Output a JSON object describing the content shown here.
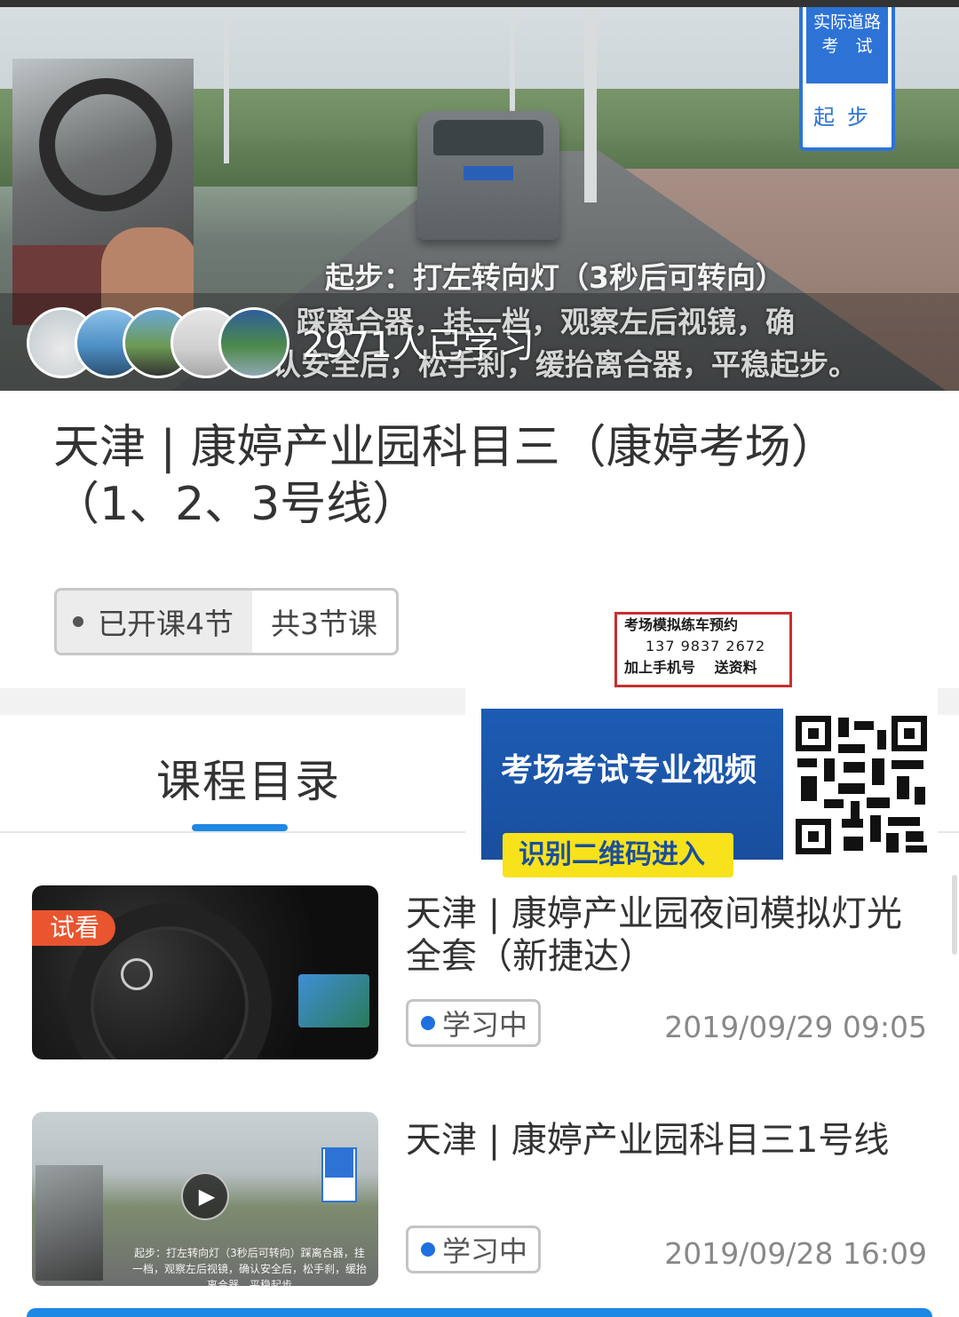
{
  "hero": {
    "learners_text": "2971人已学习",
    "caption_line1": "起步：打左转向灯（3秒后可转向）",
    "caption_line2": "踩离合器，挂一档，观察左后视镜，确",
    "caption_line3": "认安全后，松手刹，缓抬离合器，平稳起步。",
    "sign_top": "实际道路考　试",
    "sign_bottom": "起步",
    "avatars": [
      "learner-avatar-1",
      "learner-avatar-2",
      "learner-avatar-3",
      "learner-avatar-4",
      "learner-avatar-5"
    ]
  },
  "course": {
    "title": "天津 | 康婷产业园科目三（康婷考场）（1、2、3号线）",
    "opened_label": "已开课4节",
    "total_label": "共3节课"
  },
  "ad_box": {
    "line1": "考场模拟练车预约",
    "line2": "137  9837  2672",
    "line3": "加上手机号　 送资料"
  },
  "promo": {
    "headline": "考场考试专业视频",
    "button": "识别二维码进入"
  },
  "catalog": {
    "tab_label": "课程目录"
  },
  "lessons": [
    {
      "title": "天津 | 康婷产业园夜间模拟灯光全套（新捷达）",
      "badge": "试看",
      "status": "学习中",
      "date": "2019/09/29 09:05"
    },
    {
      "title": "天津 | 康婷产业园科目三1号线",
      "status": "学习中",
      "date": "2019/09/28 16:09",
      "thumb_caption": "起步：打左转向灯（3秒后可转向）踩离合器，挂一档，观察左后视镜，确认安全后，松手刹，缓抬离合器，平稳起步"
    }
  ],
  "colors": {
    "accent": "#1e88e5",
    "badge": "#e8552e",
    "status_dot": "#1e6fe0",
    "promo_blue": "#1a4e9e",
    "promo_yellow": "#f7e21b",
    "ad_border": "#c63030"
  }
}
